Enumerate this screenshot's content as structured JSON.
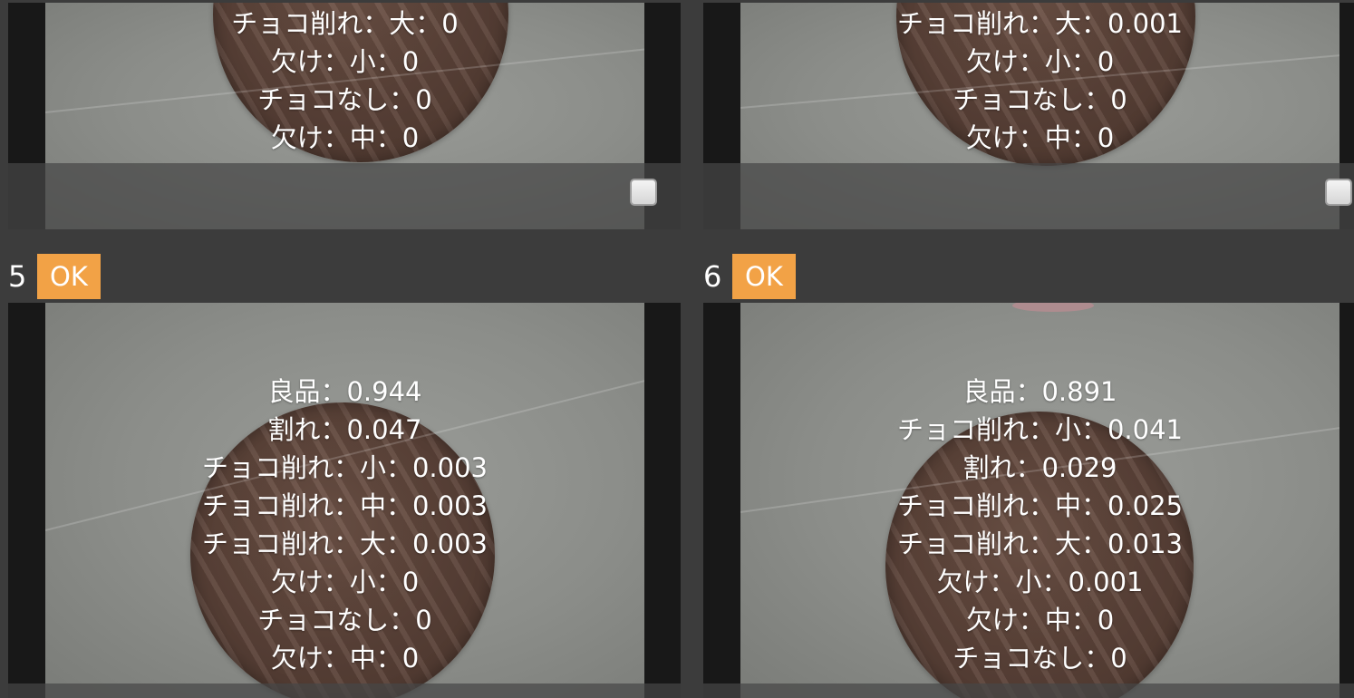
{
  "top_left": {
    "scores": [
      "チョコ削れ：大：0",
      "欠け：小：0",
      "チョコなし：0",
      "欠け：中：0"
    ]
  },
  "top_right": {
    "scores": [
      "チョコ削れ：大：0.001",
      "欠け：小：0",
      "チョコなし：0",
      "欠け：中：0"
    ]
  },
  "result5": {
    "number": "5",
    "status": "OK",
    "scores": [
      "良品：0.944",
      "割れ：0.047",
      "チョコ削れ：小：0.003",
      "チョコ削れ：中：0.003",
      "チョコ削れ：大：0.003",
      "欠け：小：0",
      "チョコなし：0",
      "欠け：中：0"
    ]
  },
  "result6": {
    "number": "6",
    "status": "OK",
    "scores": [
      "良品：0.891",
      "チョコ削れ：小：0.041",
      "割れ：0.029",
      "チョコ削れ：中：0.025",
      "チョコ削れ：大：0.013",
      "欠け：小：0.001",
      "欠け：中：0",
      "チョコなし：0"
    ]
  },
  "colors": {
    "background": "#3c3c3c",
    "ok_badge": "#f2a246",
    "card_border": "#181818",
    "text": "#ffffff"
  }
}
